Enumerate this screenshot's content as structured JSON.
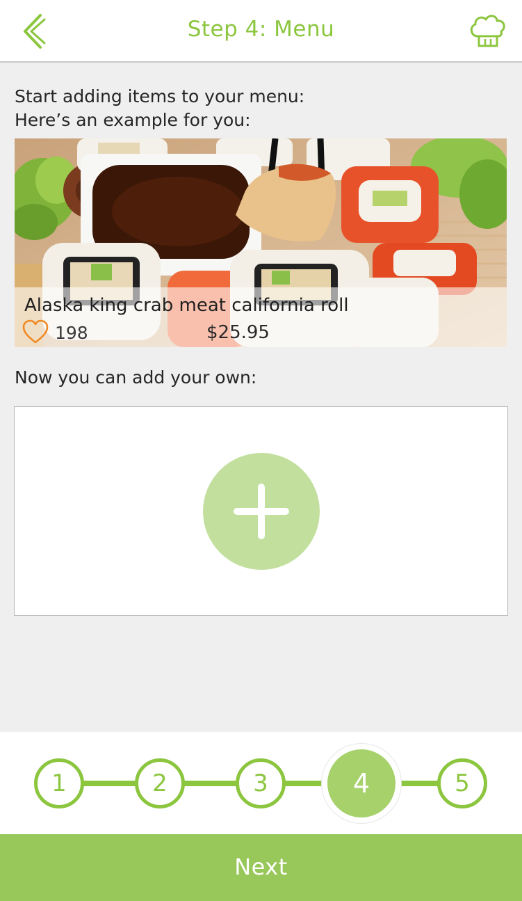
{
  "header": {
    "title": "Step 4: Menu",
    "back_icon": "chevron-left-icon",
    "right_icon": "chef-hat-icon",
    "accent_color": "#8cc63f"
  },
  "intro": {
    "line1": "Start adding items to your menu:",
    "line2": "Here’s an example for you:"
  },
  "example_item": {
    "name": "Alaska king crab meat california roll",
    "likes": "198",
    "price": "$25.95",
    "like_icon": "heart-icon",
    "heart_color": "#f08a24"
  },
  "own_section": {
    "label": "Now you can add your own:",
    "add_icon": "plus-icon",
    "add_color": "#c2df9d"
  },
  "stepper": {
    "steps": [
      "1",
      "2",
      "3",
      "4",
      "5"
    ],
    "current_step": "4"
  },
  "footer": {
    "next_label": "Next",
    "button_color": "#98c75a"
  }
}
